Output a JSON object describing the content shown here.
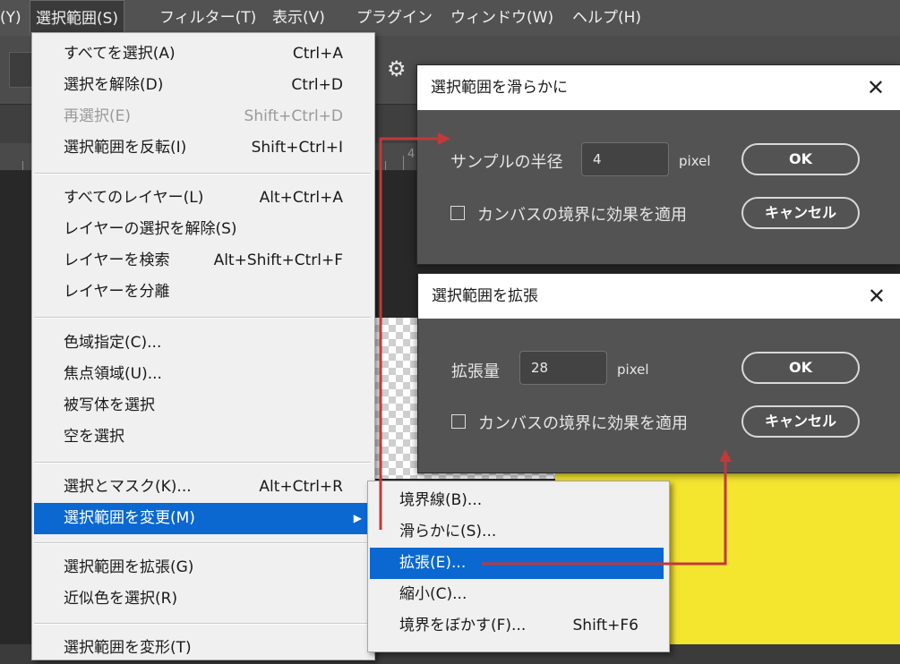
{
  "menubar": {
    "items": [
      {
        "label": "(Y)"
      },
      {
        "label": "選択範囲(S)"
      },
      {
        "label": "フィルター(T)"
      },
      {
        "label": "表示(V)"
      },
      {
        "label": "プラグイン"
      },
      {
        "label": "ウィンドウ(W)"
      },
      {
        "label": "ヘルプ(H)"
      }
    ]
  },
  "ruler": {
    "number": "4"
  },
  "select_menu": {
    "items": [
      {
        "label": "すべてを選択(A)",
        "shortcut": "Ctrl+A"
      },
      {
        "label": "選択を解除(D)",
        "shortcut": "Ctrl+D"
      },
      {
        "label": "再選択(E)",
        "shortcut": "Shift+Ctrl+D"
      },
      {
        "label": "選択範囲を反転(I)",
        "shortcut": "Shift+Ctrl+I"
      },
      {
        "label": "すべてのレイヤー(L)",
        "shortcut": "Alt+Ctrl+A"
      },
      {
        "label": "レイヤーの選択を解除(S)",
        "shortcut": ""
      },
      {
        "label": "レイヤーを検索",
        "shortcut": "Alt+Shift+Ctrl+F"
      },
      {
        "label": "レイヤーを分離",
        "shortcut": ""
      },
      {
        "label": "色域指定(C)...",
        "shortcut": ""
      },
      {
        "label": "焦点領域(U)...",
        "shortcut": ""
      },
      {
        "label": "被写体を選択",
        "shortcut": ""
      },
      {
        "label": "空を選択",
        "shortcut": ""
      },
      {
        "label": "選択とマスク(K)...",
        "shortcut": "Alt+Ctrl+R"
      },
      {
        "label": "選択範囲を変更(M)",
        "shortcut": ""
      },
      {
        "label": "選択範囲を拡張(G)",
        "shortcut": ""
      },
      {
        "label": "近似色を選択(R)",
        "shortcut": ""
      },
      {
        "label": "選択範囲を変形(T)",
        "shortcut": ""
      }
    ]
  },
  "modify_submenu": {
    "items": [
      {
        "label": "境界線(B)...",
        "shortcut": ""
      },
      {
        "label": "滑らかに(S)...",
        "shortcut": ""
      },
      {
        "label": "拡張(E)...",
        "shortcut": ""
      },
      {
        "label": "縮小(C)...",
        "shortcut": ""
      },
      {
        "label": "境界をぼかす(F)...",
        "shortcut": "Shift+F6"
      }
    ]
  },
  "smooth_dialog": {
    "title": "選択範囲を滑らかに",
    "field_label": "サンプルの半径",
    "value": "4",
    "unit": "pixel",
    "checkbox_label": "カンバスの境界に効果を適用",
    "checkbox_checked": false,
    "ok_label": "OK",
    "cancel_label": "キャンセル"
  },
  "expand_dialog": {
    "title": "選択範囲を拡張",
    "field_label": "拡張量",
    "value": "28",
    "unit": "pixel",
    "checkbox_label": "カンバスの境界に効果を適用",
    "checkbox_checked": false,
    "ok_label": "OK",
    "cancel_label": "キャンセル"
  },
  "colors": {
    "highlight": "#0a68d0",
    "annotation_arrow": "#c0393b",
    "canvas_fill": "#f4e52f"
  }
}
